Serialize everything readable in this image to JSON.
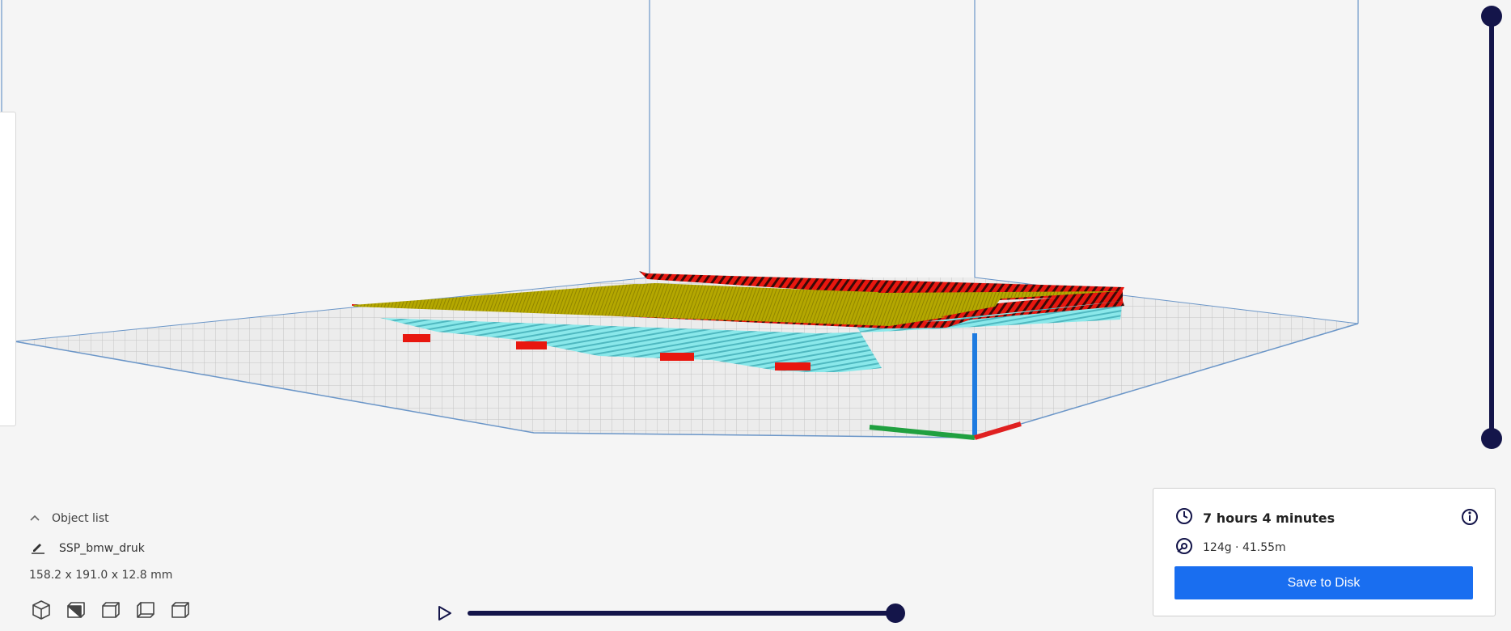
{
  "object_list": {
    "toggle_label": "Object list",
    "object_name": "SSP_bmw_druk",
    "dimensions": "158.2 x 191.0 x 12.8 mm",
    "view_buttons": [
      "view-3d",
      "view-front",
      "view-top",
      "view-left",
      "view-right"
    ]
  },
  "print_info": {
    "time": "7 hours 4 minutes",
    "material": "124g · 41.55m",
    "save_label": "Save to Disk"
  },
  "layer_slider": {
    "top_position": 1.0,
    "bottom_position": 0.0
  },
  "simulation_slider": {
    "position": 1.0
  },
  "colors": {
    "accent": "#196ef0",
    "slider": "#14154a",
    "top_skin": "#b8ac00",
    "wall": "#e8170f",
    "support": "#7fe3e6",
    "axis_x": "#e02020",
    "axis_y": "#20a040",
    "axis_z": "#1e7be0"
  },
  "icons": [
    "chevron-up-icon",
    "pencil-icon",
    "clock-icon",
    "spool-icon",
    "info-icon",
    "play-icon"
  ]
}
